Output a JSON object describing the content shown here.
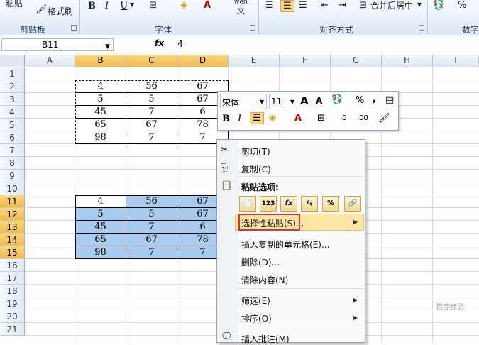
{
  "ribbon": {
    "clipboard_top": "粘贴",
    "format_painter": "格式刷",
    "clipboard_group": "剪贴板",
    "font_group": "字体",
    "align_group": "对齐方式",
    "number_group": "数字",
    "bold": "B",
    "italic": "I",
    "underline": "U",
    "wen": "wén",
    "wen_char": "文",
    "merge_center": "合并后居中",
    "percent": "%"
  },
  "formula_bar": {
    "name_box": "B11",
    "fx": "fx",
    "value": "4"
  },
  "columns": [
    "A",
    "B",
    "C",
    "D",
    "E",
    "F",
    "G",
    "H",
    "I"
  ],
  "rows": [
    "1",
    "2",
    "3",
    "4",
    "5",
    "6",
    "7",
    "8",
    "9",
    "10",
    "11",
    "12",
    "13",
    "14",
    "15",
    "16",
    "17",
    "18",
    "19",
    "20",
    "21"
  ],
  "source_table": [
    [
      "4",
      "56",
      "67"
    ],
    [
      "5",
      "5",
      "67"
    ],
    [
      "45",
      "7",
      "6"
    ],
    [
      "65",
      "67",
      "78"
    ],
    [
      "98",
      "7",
      "7"
    ]
  ],
  "pasted_table": [
    [
      "4",
      "56",
      "67"
    ],
    [
      "5",
      "5",
      "67"
    ],
    [
      "45",
      "7",
      "6"
    ],
    [
      "65",
      "67",
      "78"
    ],
    [
      "98",
      "7",
      "7"
    ]
  ],
  "mini_toolbar": {
    "font": "宋体",
    "size": "11",
    "grow": "A",
    "shrink": "A",
    "percent": "%",
    "comma": ",",
    "bold": "B",
    "italic": "I",
    "font_color": "A",
    "dec_inc": ".0",
    "dec_dec": ".00"
  },
  "context_menu": {
    "cut": "剪切(T)",
    "copy": "复制(C)",
    "paste_options": "粘贴选项:",
    "paste_values": "123",
    "paste_formula": "fx",
    "paste_special": "选择性粘贴(S)...",
    "insert_copied": "插入复制的单元格(E)...",
    "delete": "删除(D)...",
    "clear": "清除内容(N)",
    "filter": "筛选(E)",
    "sort": "排序(O)",
    "insert_comment": "插入批注(M)"
  },
  "watermark": "百度经验",
  "colors": {
    "selection_blue": "#a9cbee",
    "header_highlight": "#f0b94a",
    "highlight_red": "#e0342e"
  }
}
